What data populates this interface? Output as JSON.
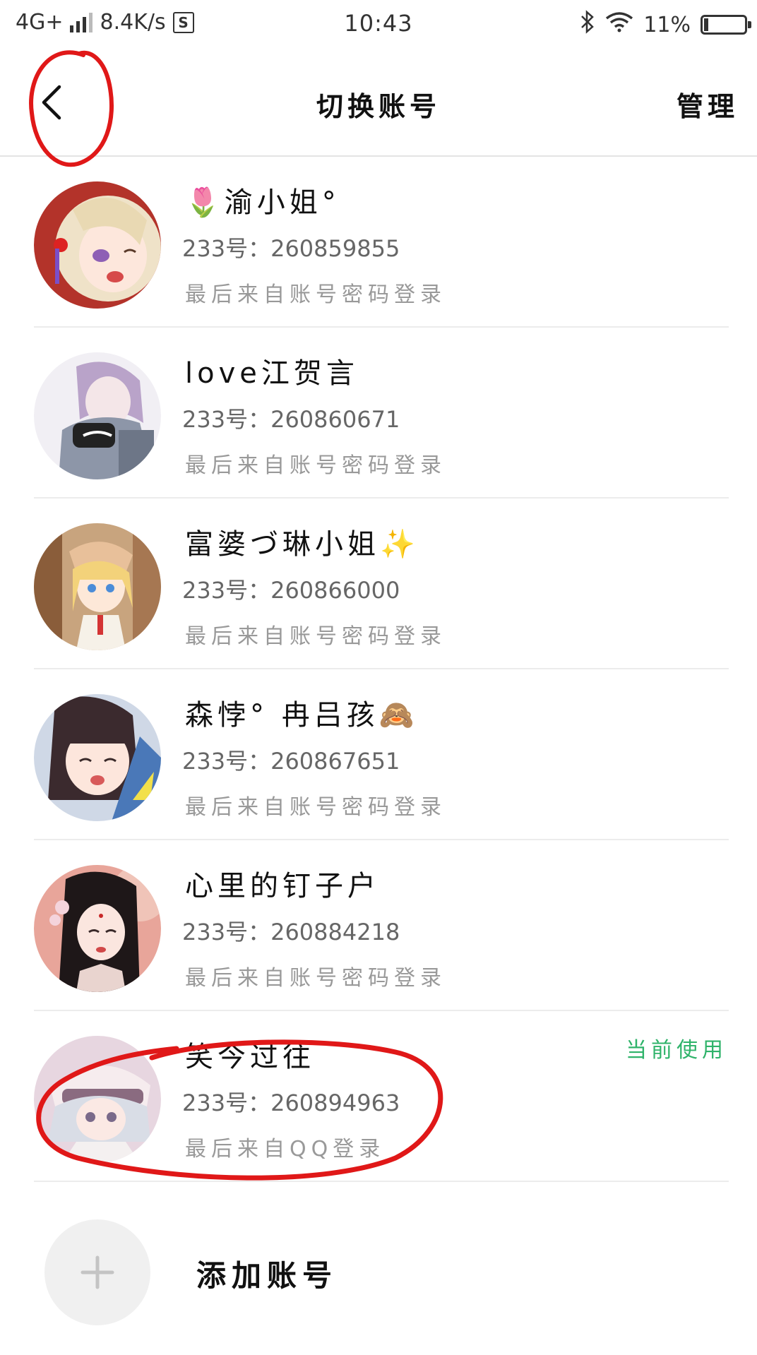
{
  "status_bar": {
    "network": "4G+",
    "speed": "8.4K/s",
    "s_badge": "S",
    "time": "10:43",
    "battery_percent": "11%",
    "battery_level": 0.11
  },
  "header": {
    "title": "切换账号",
    "manage_label": "管理"
  },
  "accounts": [
    {
      "name": "🌷渝小姐°",
      "id": "233号：260859855",
      "login": "最后来自账号密码登录",
      "current": ""
    },
    {
      "name": "love江贺言",
      "id": "233号：260860671",
      "login": "最后来自账号密码登录",
      "current": ""
    },
    {
      "name": "富婆づ琳小姐✨",
      "id": "233号：260866000",
      "login": "最后来自账号密码登录",
      "current": ""
    },
    {
      "name": "森悖° 冉吕孩🙈",
      "id": "233号：260867651",
      "login": "最后来自账号密码登录",
      "current": ""
    },
    {
      "name": "心里的钉子户",
      "id": "233号：260884218",
      "login": "最后来自账号密码登录",
      "current": ""
    },
    {
      "name": "笑今过往",
      "id": "233号：260894963",
      "login": "最后来自QQ登录",
      "current": "当前使用"
    }
  ],
  "add_account_label": "添加账号",
  "colors": {
    "current_badge": "#2fb36a",
    "annotation": "#e01818"
  }
}
